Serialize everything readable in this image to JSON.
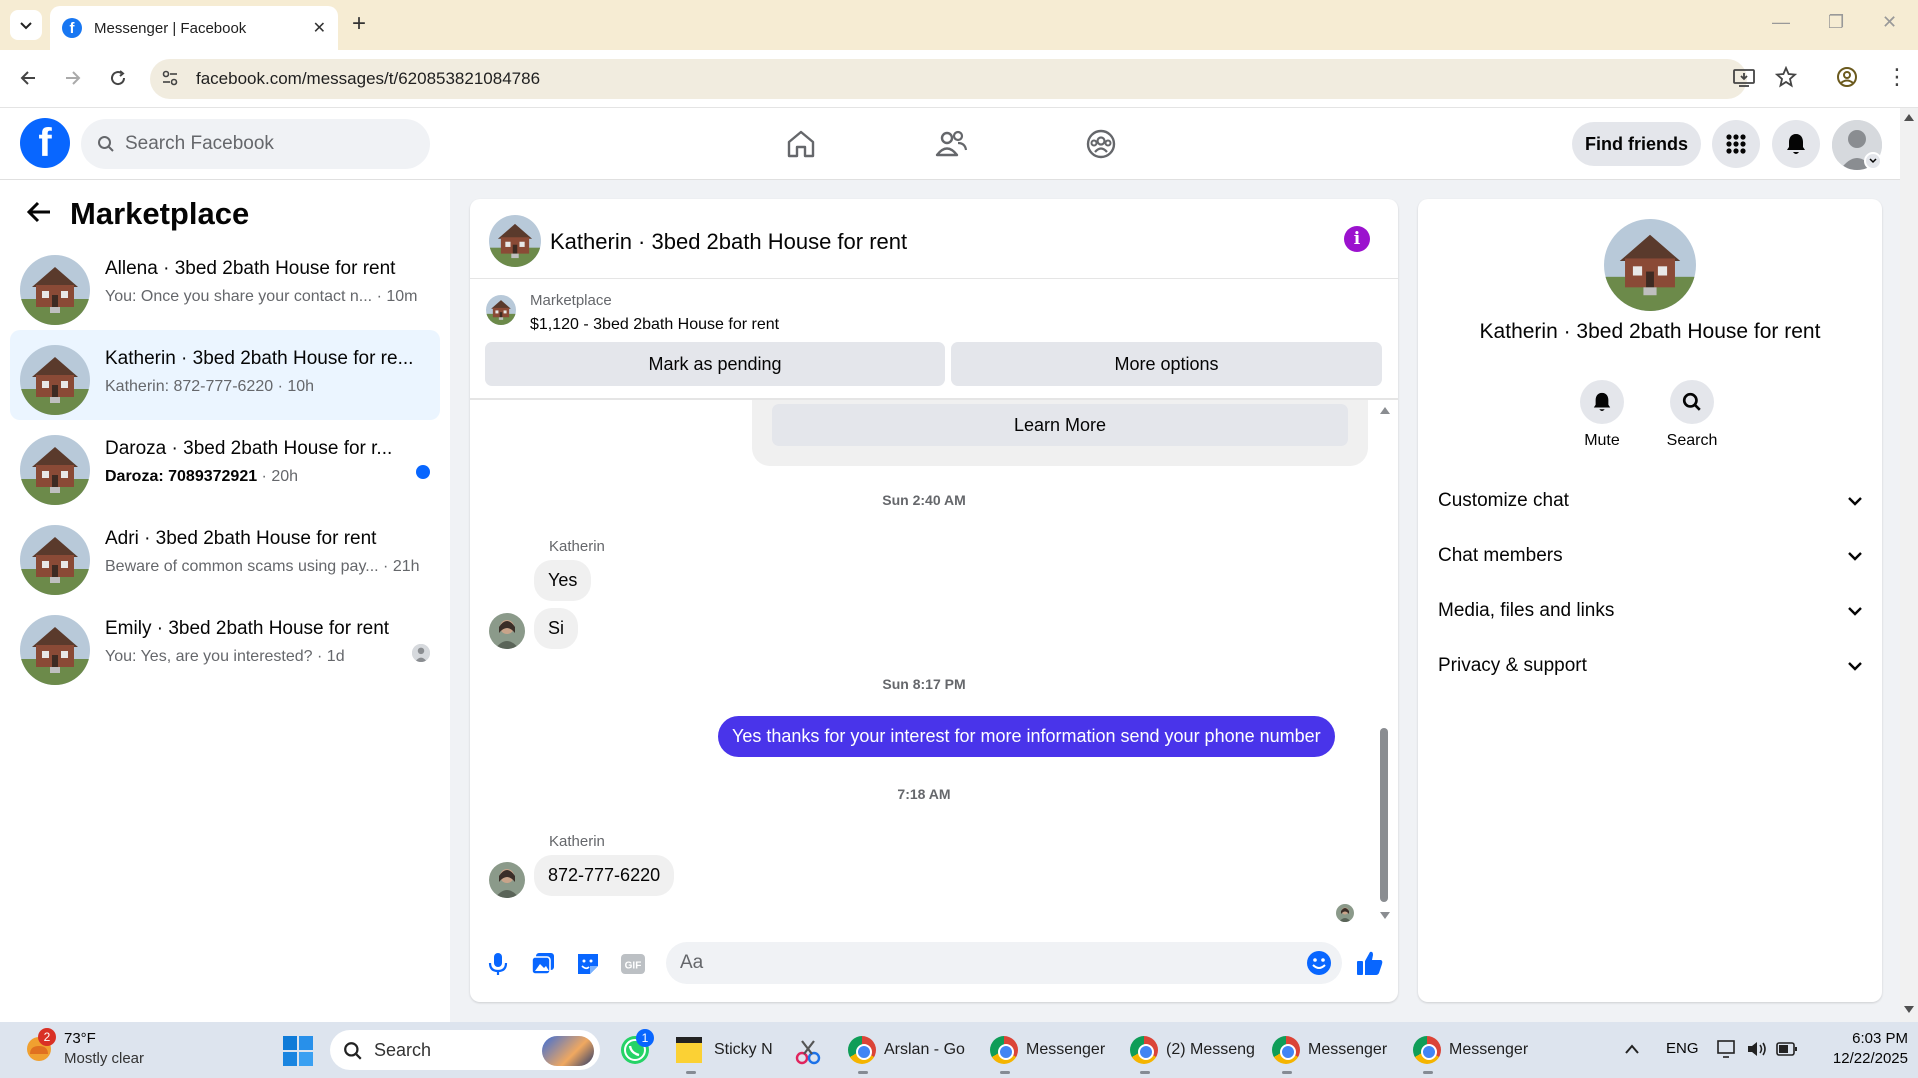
{
  "browser": {
    "tab_title": "Messenger | Facebook",
    "url": "facebook.com/messages/t/620853821084786"
  },
  "fb": {
    "search_placeholder": "Search Facebook",
    "find_friends": "Find friends"
  },
  "sidebar": {
    "title": "Marketplace",
    "conversations": [
      {
        "name": "Allena · 3bed 2bath House for rent",
        "preview": "You: Once you share your contact n...",
        "time": "10m"
      },
      {
        "name": "Katherin · 3bed 2bath House for re...",
        "preview": "Katherin: 872-777-6220",
        "time": "10h"
      },
      {
        "name": "Daroza · 3bed 2bath House for r...",
        "preview": "Daroza: 7089372921",
        "time": "20h"
      },
      {
        "name": "Adri · 3bed 2bath House for rent",
        "preview": "Beware of common scams using pay...",
        "time": "21h"
      },
      {
        "name": "Emily · 3bed 2bath House for rent",
        "preview": "You: Yes, are you interested?",
        "time": "1d"
      }
    ]
  },
  "chat": {
    "title": "Katherin · 3bed 2bath House for rent",
    "marketplace_label": "Marketplace",
    "listing": "$1,120 - 3bed 2bath House for rent",
    "mark_pending": "Mark as pending",
    "more_options": "More options",
    "learn_more": "Learn More",
    "timestamps": [
      "Sun 2:40 AM",
      "Sun 8:17 PM",
      "7:18 AM"
    ],
    "sender": "Katherin",
    "messages": {
      "m1": "Yes",
      "m2": "Si",
      "m3": "Yes thanks for your interest for more information send your phone number",
      "m4": "872-777-6220"
    },
    "composer_placeholder": "Aa"
  },
  "details": {
    "name": "Katherin · 3bed 2bath House for rent",
    "mute": "Mute",
    "search": "Search",
    "sections": [
      "Customize chat",
      "Chat members",
      "Media, files and links",
      "Privacy & support"
    ]
  },
  "taskbar": {
    "weather_temp": "73°F",
    "weather_desc": "Mostly clear",
    "weather_badge": "2",
    "search": "Search",
    "whatsapp_badge": "1",
    "apps": [
      "Sticky N",
      "Arslan - Go",
      "Messenger",
      "(2) Messeng",
      "Messenger",
      "Messenger"
    ],
    "lang": "ENG",
    "time": "6:03 PM",
    "date": "12/22/2025"
  },
  "colors": {
    "fb_blue": "#0866ff",
    "outgoing_bubble": "#4934ea",
    "info_purple": "#9b12ce"
  }
}
